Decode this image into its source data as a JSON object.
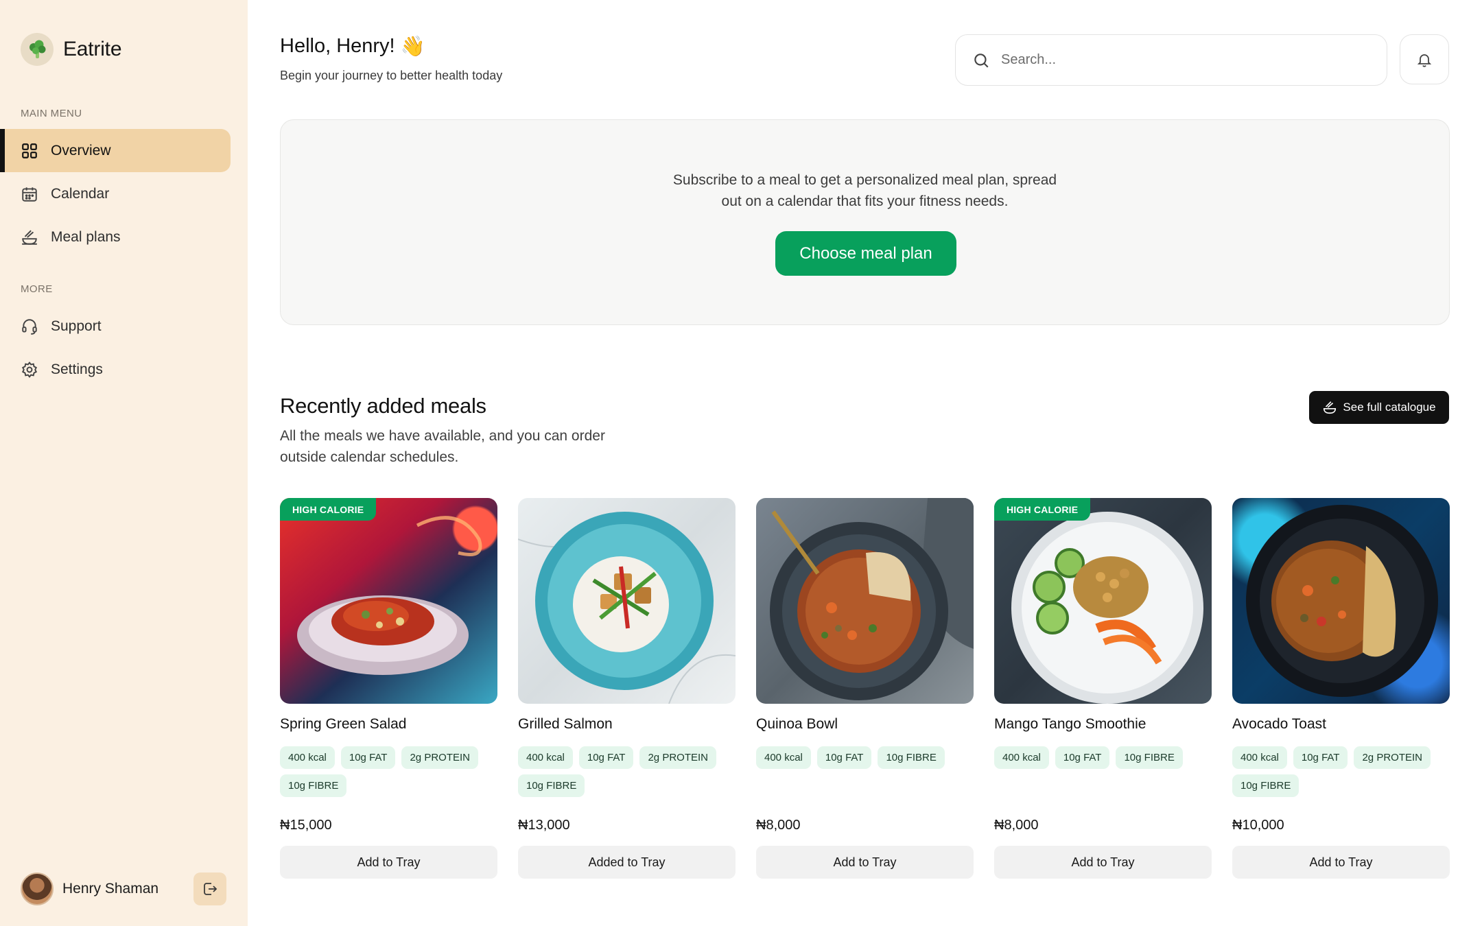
{
  "app": {
    "name": "Eatrite"
  },
  "sidebar": {
    "main_menu_label": "MAIN MENU",
    "main_items": [
      {
        "label": "Overview",
        "icon": "grid-icon",
        "active": true
      },
      {
        "label": "Calendar",
        "icon": "calendar-icon",
        "active": false
      },
      {
        "label": "Meal plans",
        "icon": "meal-plan-icon",
        "active": false
      }
    ],
    "more_label": "MORE",
    "more_items": [
      {
        "label": "Support",
        "icon": "headset-icon"
      },
      {
        "label": "Settings",
        "icon": "gear-icon"
      }
    ],
    "user": {
      "name": "Henry Shaman"
    }
  },
  "header": {
    "greeting": "Hello, Henry!",
    "greeting_emoji": "👋",
    "subtitle": "Begin your journey to better health today",
    "search_placeholder": "Search..."
  },
  "promo": {
    "line1": "Subscribe to a meal to get a personalized meal plan, spread",
    "line2": "out on a calendar that fits your fitness needs.",
    "button_label": "Choose meal plan"
  },
  "recent": {
    "title": "Recently added meals",
    "description": "All the meals we have available, and you can order outside calendar schedules.",
    "catalogue_button": "See full catalogue",
    "meals": [
      {
        "name": "Spring Green Salad",
        "badge": "HIGH CALORIE",
        "tags": [
          "400 kcal",
          "10g FAT",
          "2g PROTEIN",
          "10g FIBRE"
        ],
        "price": "₦15,000",
        "button": "Add to Tray"
      },
      {
        "name": "Grilled Salmon",
        "badge": "",
        "tags": [
          "400 kcal",
          "10g FAT",
          "2g PROTEIN",
          "10g FIBRE"
        ],
        "price": "₦13,000",
        "button": "Added to Tray"
      },
      {
        "name": "Quinoa Bowl",
        "badge": "",
        "tags": [
          "400 kcal",
          "10g FAT",
          "10g FIBRE"
        ],
        "price": "₦8,000",
        "button": "Add to Tray"
      },
      {
        "name": "Mango Tango Smoothie",
        "badge": "HIGH CALORIE",
        "tags": [
          "400 kcal",
          "10g FAT",
          "10g FIBRE"
        ],
        "price": "₦8,000",
        "button": "Add to Tray"
      },
      {
        "name": "Avocado Toast",
        "badge": "",
        "tags": [
          "400 kcal",
          "10g FAT",
          "2g PROTEIN",
          "10g FIBRE"
        ],
        "price": "₦10,000",
        "button": "Add to Tray"
      }
    ]
  },
  "colors": {
    "accent": "#08a05c",
    "sidebar_bg": "#fbf0e2",
    "active_nav": "#f1d3a6",
    "tag_bg": "#e4f6ec"
  }
}
